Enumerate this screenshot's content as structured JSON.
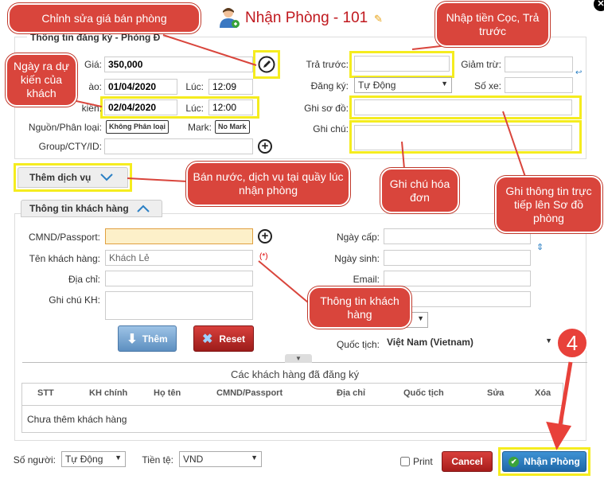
{
  "title": {
    "text": "Nhận Phòng - 101"
  },
  "callouts": {
    "edit_price": "Chỉnh sửa giá bán phòng",
    "deposit": "Nhập tiền Cọc, Trả trước",
    "checkout": "Ngày ra dự kiến của khách",
    "services": "Bán nước, dịch vụ tại quầy lúc nhận phòng",
    "invoice_note": "Ghi chú hóa đơn",
    "map_note": "Ghi thông tin trực tiếp lên Sơ đồ phòng",
    "customer_info": "Thông tin khách hàng",
    "step": "4"
  },
  "registration": {
    "legend": "Thông tin đăng ký - Phòng Đ",
    "price_label": "Giá:",
    "price_value": "350,000",
    "checkin_label": "ào:",
    "checkin_date": "01/04/2020",
    "checkin_time_label": "Lúc:",
    "checkin_time": "12:09",
    "checkout_label": "kiến:",
    "checkout_date": "02/04/2020",
    "checkout_time_label": "Lúc:",
    "checkout_time": "12:00",
    "source_label": "Nguồn/Phân loại:",
    "source_value": "Không Phân loại",
    "mark_label": "Mark:",
    "mark_value": "No Mark",
    "group_label": "Group/CTY/ID:",
    "prepaid_label": "Trả trước:",
    "discount_label": "Giảm trừ:",
    "register_label": "Đăng ký:",
    "register_value": "Tự Động",
    "vehicle_label": "Số xe:",
    "map_note_label": "Ghi sơ đồ:",
    "note_label": "Ghi chú:"
  },
  "services": {
    "label": "Thêm dịch vụ"
  },
  "customer": {
    "section_label": "Thông tin khách hàng",
    "id_label": "CMND/Passport:",
    "name_label": "Tên khách hàng:",
    "name_value": "Khách Lẻ",
    "required": "(*)",
    "address_label": "Địa chỉ:",
    "note_label": "Ghi chú KH:",
    "issue_date_label": "Ngày cấp:",
    "birth_label": "Ngày sinh:",
    "email_label": "Email:",
    "nationality_label": "Quốc tịch:",
    "nationality_value": "Việt Nam (Vietnam)",
    "add_button": "Thêm",
    "reset_button": "Reset"
  },
  "registered": {
    "title": "Các khách hàng đã đăng ký",
    "columns": [
      "STT",
      "KH chính",
      "Họ tên",
      "CMND/Passport",
      "Địa chỉ",
      "Quốc tịch",
      "Sửa",
      "Xóa"
    ],
    "empty": "Chưa thêm khách hàng"
  },
  "footer": {
    "people_label": "Số người:",
    "people_value": "Tự Động",
    "currency_label": "Tiền tệ:",
    "currency_value": "VND",
    "print_label": "Print",
    "cancel_button": "Cancel",
    "checkin_button": "Nhận Phòng"
  },
  "colors": {
    "accent_red": "#c0181e",
    "callout": "#d9453c",
    "highlight": "#f5ec1f",
    "primary_button": "#2a7fc4",
    "danger_button": "#b8201f"
  }
}
